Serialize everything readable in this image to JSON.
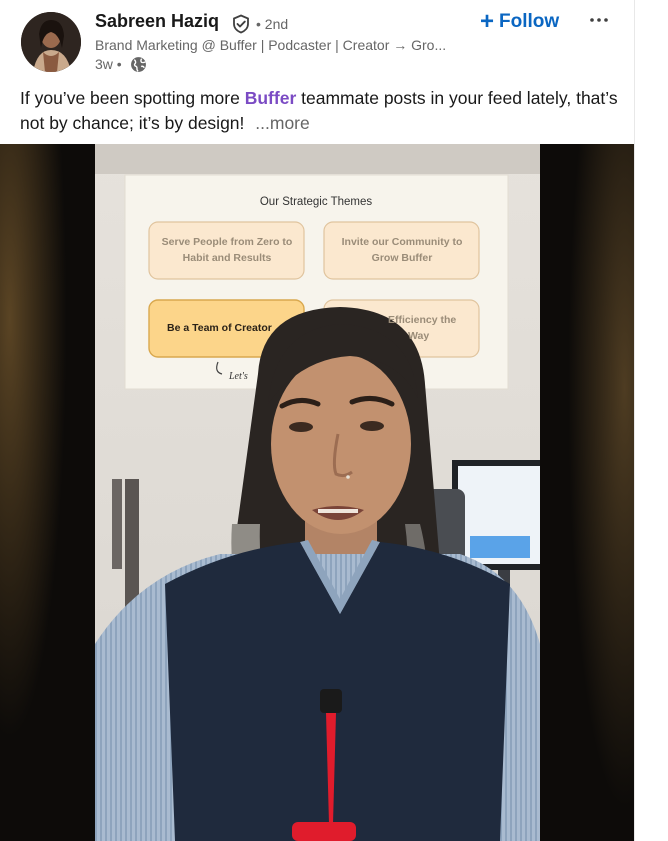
{
  "post": {
    "author": {
      "name": "Sabreen Haziq",
      "degree": "• 2nd",
      "headline": "Brand Marketing @ Buffer | Podcaster | Creator → Gro...",
      "time_ago": "3w •",
      "verified_icon": "verified-shield-icon",
      "visibility_icon": "globe-icon"
    },
    "follow_label": "Follow",
    "text": {
      "before": "If you’ve been spotting more",
      "brand": "Buffer",
      "after": "teammate posts in your feed lately, that’s not by chance; it’s by design!",
      "see_more": "...more"
    },
    "colors": {
      "link_blue": "#0a66c2",
      "brand_purple": "#7b4bc4"
    }
  },
  "video": {
    "board_title": "Our Strategic Themes",
    "themes": [
      {
        "line1": "Serve People from Zero to",
        "line2": "Habit and Results"
      },
      {
        "line1": "Invite our Community to",
        "line2": "Grow Buffer"
      },
      {
        "line1": "Be a Team of Creator",
        "line2": ""
      },
      {
        "line1": "Efficiency the",
        "line2": "Way"
      }
    ],
    "handwritten_note": "Let's"
  }
}
